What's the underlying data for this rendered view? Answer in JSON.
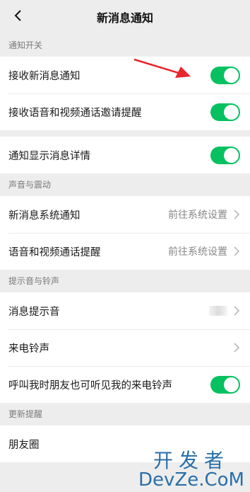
{
  "header": {
    "title": "新消息通知"
  },
  "sections": {
    "notify": {
      "label": "通知开关",
      "items": [
        {
          "label": "接收新消息通知",
          "enabled": true
        },
        {
          "label": "接收语音和视频通话邀请提醒",
          "enabled": true
        }
      ],
      "detail": {
        "label": "通知显示消息详情",
        "enabled": true
      }
    },
    "sound": {
      "label": "声音与震动",
      "items": [
        {
          "label": "新消息系统通知",
          "value": "前往系统设置"
        },
        {
          "label": "语音和视频通话提醒",
          "value": "前往系统设置"
        }
      ]
    },
    "tone": {
      "label": "提示音与铃声",
      "items": [
        {
          "label": "消息提示音"
        },
        {
          "label": "来电铃声"
        },
        {
          "label": "呼叫我时朋友也可听见我的来电铃声",
          "enabled": true
        }
      ]
    },
    "updates": {
      "label": "更新提醒",
      "items": [
        {
          "label": "朋友圈"
        }
      ]
    }
  },
  "watermark": {
    "top": "开发者",
    "bottom": "DevZe.CoM"
  },
  "colors": {
    "accent": "#07c160",
    "arrow": "#e8262d",
    "background": "#ededed"
  },
  "icons": {
    "back": "chevron-left-icon",
    "row": "chevron-right-icon"
  }
}
